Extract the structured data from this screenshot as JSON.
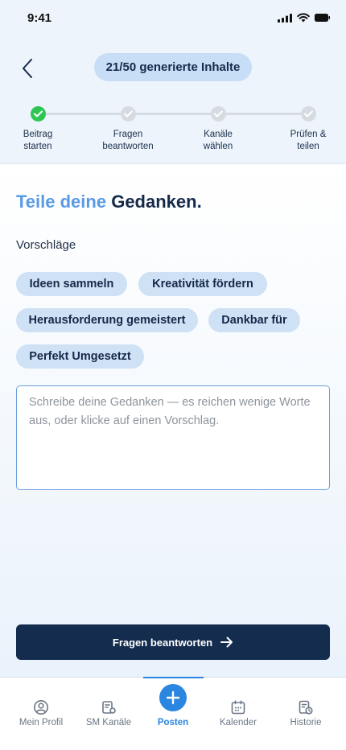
{
  "status_bar": {
    "time": "9:41"
  },
  "header": {
    "counter": "21/50 generierte Inhalte"
  },
  "steps": [
    {
      "label": "Beitrag starten",
      "line1": "Beitrag",
      "line2": "starten",
      "state": "done"
    },
    {
      "label": "Fragen beantworten",
      "line1": "Fragen",
      "line2": "beantworten",
      "state": "pending"
    },
    {
      "label": "Kanäle wählen",
      "line1": "Kanäle",
      "line2": "wählen",
      "state": "pending"
    },
    {
      "label": "Prüfen & teilen",
      "line1": "Prüfen &",
      "line2": "teilen",
      "state": "pending"
    }
  ],
  "main": {
    "headline_accent": "Teile deine",
    "headline_rest": "Gedanken.",
    "suggestions_title": "Vorschläge",
    "suggestions": [
      "Ideen sammeln",
      "Kreativität fördern",
      "Herausforderung gemeistert",
      "Dankbar für",
      "Perfekt Umgesetzt"
    ],
    "textarea_placeholder": "Schreibe deine Gedanken — es reichen wenige Worte aus, oder klicke auf einen Vorschlag.",
    "cta_label": "Fragen beantworten"
  },
  "tabbar": {
    "items": [
      {
        "label": "Mein Profil",
        "icon": "profile-icon"
      },
      {
        "label": "SM Kanäle",
        "icon": "channels-icon"
      },
      {
        "label": "Posten",
        "icon": "plus-icon",
        "active": true
      },
      {
        "label": "Kalender",
        "icon": "calendar-icon"
      },
      {
        "label": "Historie",
        "icon": "history-icon"
      }
    ]
  },
  "colors": {
    "primary_dark": "#142c4e",
    "accent_blue": "#2a86e0",
    "headline_accent": "#5a9be4",
    "chip_bg": "#cfe1f5",
    "success_green": "#2dc653"
  }
}
